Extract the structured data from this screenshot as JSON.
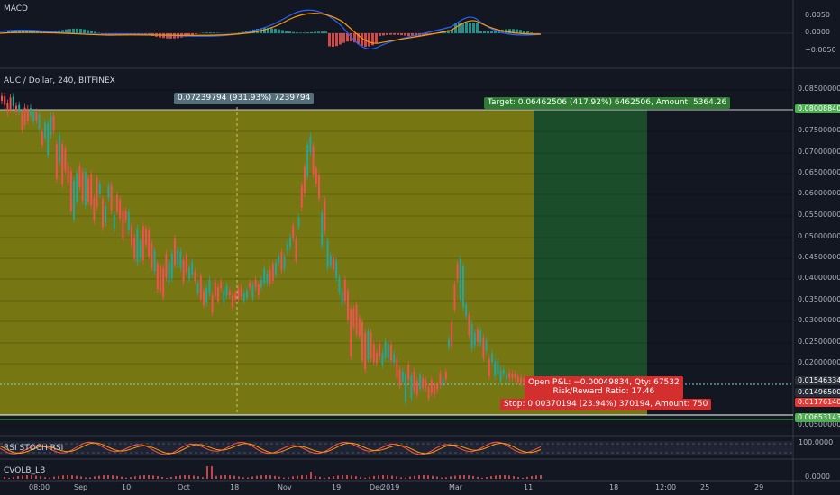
{
  "symbol_label": "AUC / Dollar, 240, BITFINEX",
  "panes": {
    "macd_label": "MACD",
    "rsi_label": "RSI STOCH RSI",
    "cvol_label": "CVOLB_LB"
  },
  "macd_axis": [
    "0.0050",
    "0.0000",
    "−0.0050"
  ],
  "price_axis": [
    "0.08500000",
    "0.07500000",
    "0.07000000",
    "0.06500000",
    "0.06000000",
    "0.05500000",
    "0.05000000",
    "0.04500000",
    "0.04000000",
    "0.03500000",
    "0.03000000",
    "0.02500000",
    "0.02000000",
    "0.00500000"
  ],
  "price_badges": [
    {
      "text": "0.08008840",
      "color": "#4caf50"
    },
    {
      "text": "0.01546334",
      "color": "#2a2e39"
    },
    {
      "text": "0.01496500",
      "color": "#2a2e39"
    },
    {
      "text": "0.01176140",
      "color": "#e53935"
    },
    {
      "text": "0.00653143",
      "color": "#4caf50"
    }
  ],
  "rsi_axis": [
    "100.0000"
  ],
  "cvol_axis": [
    "0.0000"
  ],
  "time_axis": [
    "08:00",
    "Sep",
    "10",
    "Oct",
    "18",
    "Nov",
    "19",
    "Dec",
    "2019",
    "Mar",
    "11",
    "18",
    "12:00",
    "25",
    "29"
  ],
  "measure_label": "0.07239794 (931.93%) 7239794",
  "target_label": "Target: 0.06462506 (417.92%) 6462506, Amount: 5364.26",
  "stop_label": "Stop: 0.00370194 (23.94%) 370194, Amount: 750",
  "open_pnl": {
    "line1": "Open P&L: −0.00049834, Qty: 67532",
    "line2": "Risk/Reward Ratio: 17.46"
  },
  "colors": {
    "background": "#131722",
    "up": "#26a69a",
    "down": "#ef5350",
    "stop_zone": "#7b7b12",
    "target_zone": "#1b4d2a",
    "label_green": "#2e7d32",
    "label_red": "#d32f2f"
  },
  "chart_data": {
    "type": "candlestick",
    "series_name": "AUC / Dollar, 240, BITFINEX",
    "stop_level": 0.0117614,
    "target_level": 0.0800884,
    "entry_level": 0.01546334,
    "last_price": 0.014965
  }
}
